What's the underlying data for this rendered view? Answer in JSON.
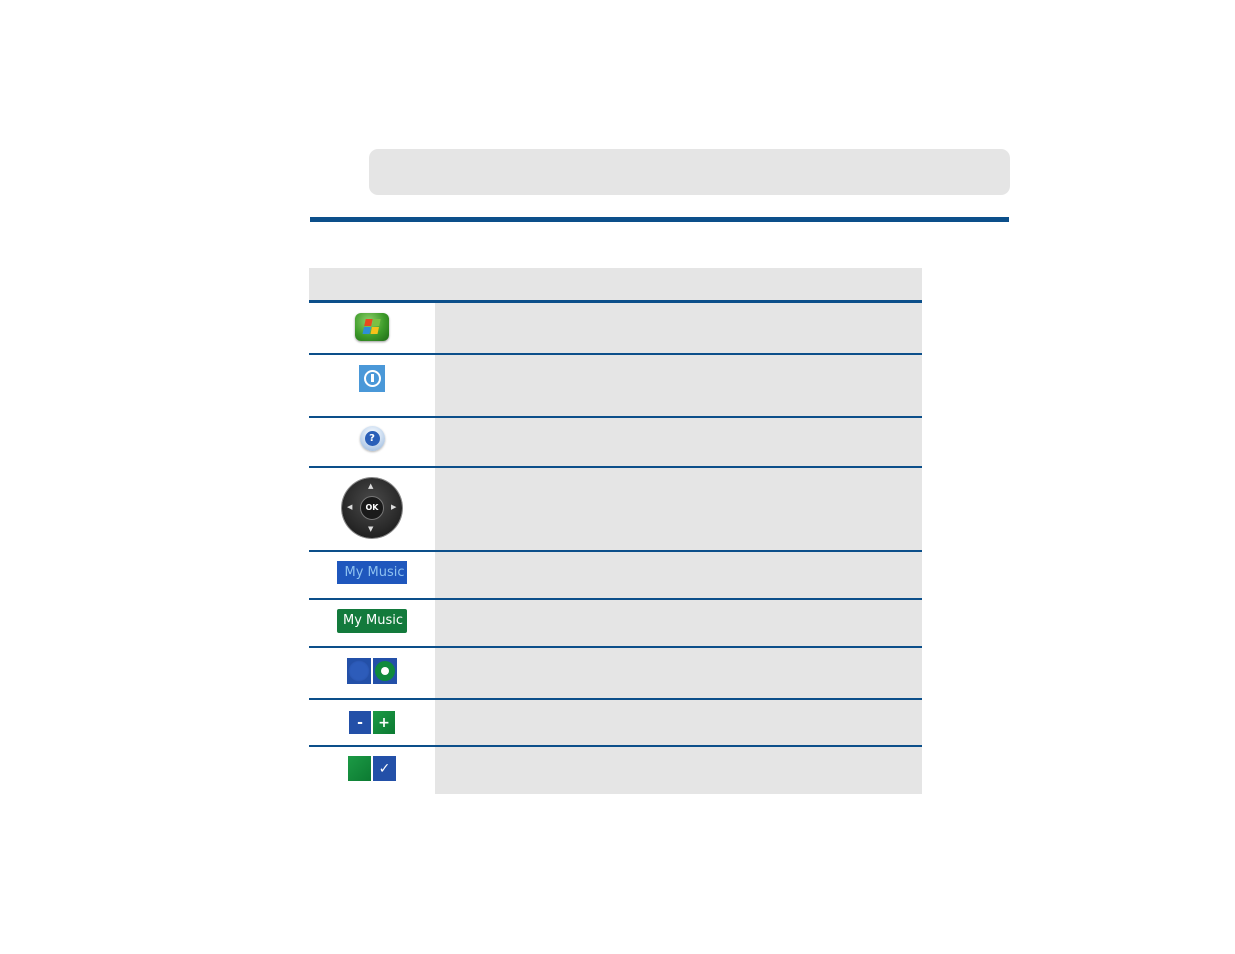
{
  "page": {
    "title_bar_text": "",
    "colors": {
      "accent_rule": "#0c4f8a",
      "panel_gray": "#e5e5e5",
      "button_blue": "#1f57bd",
      "button_green": "#137a3c"
    }
  },
  "table": {
    "header": {
      "icon_col": "",
      "desc_col": ""
    },
    "rows": [
      {
        "icon": "windows-start-button-icon",
        "label": "",
        "description": ""
      },
      {
        "icon": "power-button-icon",
        "label": "",
        "description": ""
      },
      {
        "icon": "help-button-icon",
        "label": "",
        "description": ""
      },
      {
        "icon": "remote-navigation-pad-icon",
        "label": "OK",
        "arrows": [
          "▲",
          "▼",
          "◀",
          "▶"
        ],
        "description": ""
      },
      {
        "icon": "menu-item-unfocused",
        "label": "My Music",
        "description": ""
      },
      {
        "icon": "menu-item-focused",
        "label": "My Music",
        "description": ""
      },
      {
        "icon": "radio-buttons-icon",
        "label": "",
        "description": ""
      },
      {
        "icon": "minus-plus-buttons-icon",
        "labels": [
          "-",
          "+"
        ],
        "description": ""
      },
      {
        "icon": "checkbox-icon",
        "labels": [
          "",
          "✓"
        ],
        "description": ""
      }
    ]
  }
}
